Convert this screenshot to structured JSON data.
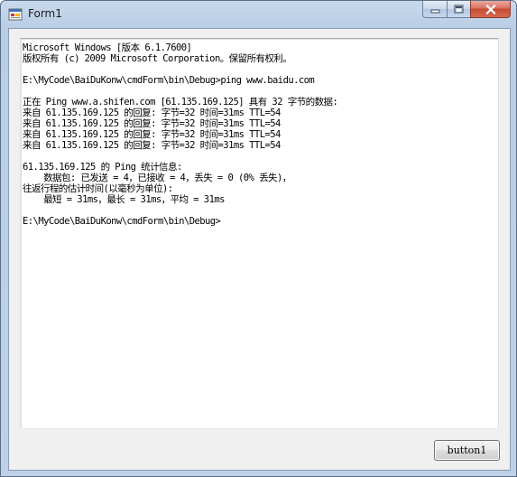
{
  "window": {
    "title": "Form1",
    "icon": "winforms-app-icon"
  },
  "caption_buttons": {
    "minimize_icon": "minimize-icon",
    "maximize_icon": "maximize-icon",
    "close_icon": "close-icon"
  },
  "console": {
    "lines": [
      "Microsoft Windows [版本 6.1.7600]",
      "版权所有 (c) 2009 Microsoft Corporation。保留所有权利。",
      "",
      "E:\\MyCode\\BaiDuKonw\\cmdForm\\bin\\Debug>ping www.baidu.com",
      "",
      "正在 Ping www.a.shifen.com [61.135.169.125] 具有 32 字节的数据:",
      "来自 61.135.169.125 的回复: 字节=32 时间=31ms TTL=54",
      "来自 61.135.169.125 的回复: 字节=32 时间=31ms TTL=54",
      "来自 61.135.169.125 的回复: 字节=32 时间=31ms TTL=54",
      "来自 61.135.169.125 的回复: 字节=32 时间=31ms TTL=54",
      "",
      "61.135.169.125 的 Ping 统计信息:",
      "    数据包: 已发送 = 4，已接收 = 4，丢失 = 0 (0% 丢失)，",
      "往返行程的估计时间(以毫秒为单位):",
      "    最短 = 31ms，最长 = 31ms，平均 = 31ms",
      "",
      "E:\\MyCode\\BaiDuKonw\\cmdForm\\bin\\Debug>"
    ]
  },
  "button1": {
    "label": "button1"
  },
  "colors": {
    "title_bar": "#bed1e8",
    "client_background": "#f0f0f0",
    "console_background": "#ffffff",
    "close_button": "#c75050"
  }
}
